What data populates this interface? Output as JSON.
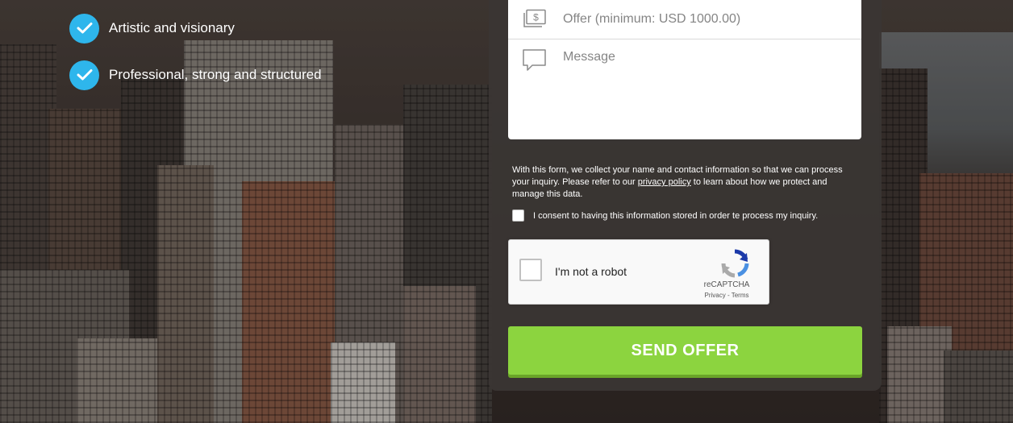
{
  "features": [
    {
      "label": "Artistic and visionary",
      "icon": "check-circle-icon"
    },
    {
      "label": "Professional, strong and structured",
      "icon": "check-circle-icon"
    }
  ],
  "form": {
    "offer_placeholder": "Offer (minimum: USD 1000.00)",
    "message_placeholder": "Message",
    "privacy_text_before": "With this form, we collect your name and contact information so that we can process your inquiry. Please refer to our ",
    "privacy_link": "privacy policy",
    "privacy_text_after": " to learn about how we protect and manage this data.",
    "consent_label": "I consent to having this information stored in order te process my inquiry.",
    "submit_label": "SEND OFFER"
  },
  "recaptcha": {
    "label": "I'm not a robot",
    "brand": "reCAPTCHA",
    "links": "Privacy - Terms"
  },
  "colors": {
    "accent_check": "#2eb6ec",
    "submit_green": "#8cd43f",
    "panel": "#3a3634"
  }
}
